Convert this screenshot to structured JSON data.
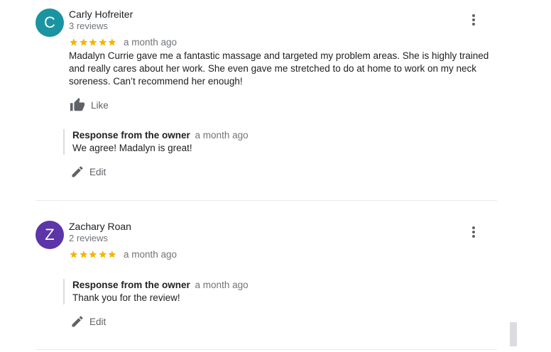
{
  "colors": {
    "star": "#f4b400",
    "avatar_1": "#1a94a0",
    "avatar_2": "#5c35a8"
  },
  "reviews": [
    {
      "initial": "C",
      "name": "Carly Hofreiter",
      "review_count": "3 reviews",
      "rating": 5,
      "time": "a month ago",
      "text": "Madalyn Currie gave me a fantastic massage and targeted my problem areas. She is highly trained and really cares about her work. She even gave me stretched to do at home to work on my neck soreness. Can’t recommend her enough!",
      "like_label": "Like",
      "owner_response": {
        "title": "Response from the owner",
        "time": "a month ago",
        "text": "We agree! Madalyn is great!"
      },
      "edit_label": "Edit"
    },
    {
      "initial": "Z",
      "name": "Zachary Roan",
      "review_count": "2 reviews",
      "rating": 5,
      "time": "a month ago",
      "owner_response": {
        "title": "Response from the owner",
        "time": "a month ago",
        "text": "Thank you for the review!"
      },
      "edit_label": "Edit"
    }
  ]
}
